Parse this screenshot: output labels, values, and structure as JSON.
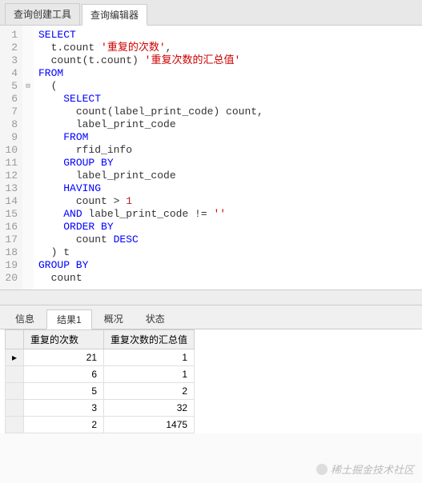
{
  "top_tabs": {
    "builder": "查询创建工具",
    "editor": "查询编辑器"
  },
  "sql_tokens": [
    [
      {
        "t": "kw",
        "v": "SELECT"
      }
    ],
    [
      {
        "t": "sp",
        "v": "  "
      },
      {
        "t": "id",
        "v": "t.count "
      },
      {
        "t": "str",
        "v": "'重复的次数'"
      },
      {
        "t": "id",
        "v": ","
      }
    ],
    [
      {
        "t": "sp",
        "v": "  "
      },
      {
        "t": "fn",
        "v": "count(t.count) "
      },
      {
        "t": "str",
        "v": "'重复次数的汇总值'"
      }
    ],
    [
      {
        "t": "kw",
        "v": "FROM"
      }
    ],
    [
      {
        "t": "sp",
        "v": "  "
      },
      {
        "t": "id",
        "v": "("
      }
    ],
    [
      {
        "t": "sp",
        "v": "    "
      },
      {
        "t": "kw",
        "v": "SELECT"
      }
    ],
    [
      {
        "t": "sp",
        "v": "      "
      },
      {
        "t": "fn",
        "v": "count(label_print_code) count,"
      }
    ],
    [
      {
        "t": "sp",
        "v": "      "
      },
      {
        "t": "id",
        "v": "label_print_code"
      }
    ],
    [
      {
        "t": "sp",
        "v": "    "
      },
      {
        "t": "kw",
        "v": "FROM"
      }
    ],
    [
      {
        "t": "sp",
        "v": "      "
      },
      {
        "t": "id",
        "v": "rfid_info"
      }
    ],
    [
      {
        "t": "sp",
        "v": "    "
      },
      {
        "t": "kw",
        "v": "GROUP BY"
      }
    ],
    [
      {
        "t": "sp",
        "v": "      "
      },
      {
        "t": "id",
        "v": "label_print_code"
      }
    ],
    [
      {
        "t": "sp",
        "v": "    "
      },
      {
        "t": "kw",
        "v": "HAVING"
      }
    ],
    [
      {
        "t": "sp",
        "v": "      "
      },
      {
        "t": "id",
        "v": "count > "
      },
      {
        "t": "num",
        "v": "1"
      }
    ],
    [
      {
        "t": "sp",
        "v": "    "
      },
      {
        "t": "kw",
        "v": "AND"
      },
      {
        "t": "id",
        "v": " label_print_code != "
      },
      {
        "t": "str",
        "v": "''"
      }
    ],
    [
      {
        "t": "sp",
        "v": "    "
      },
      {
        "t": "kw",
        "v": "ORDER BY"
      }
    ],
    [
      {
        "t": "sp",
        "v": "      "
      },
      {
        "t": "id",
        "v": "count "
      },
      {
        "t": "kw",
        "v": "DESC"
      }
    ],
    [
      {
        "t": "sp",
        "v": "  "
      },
      {
        "t": "id",
        "v": ") t"
      }
    ],
    [
      {
        "t": "kw",
        "v": "GROUP BY"
      }
    ],
    [
      {
        "t": "sp",
        "v": "  "
      },
      {
        "t": "id",
        "v": "count"
      }
    ]
  ],
  "fold_row": 5,
  "bottom_tabs": {
    "info": "信息",
    "result1": "结果1",
    "profile": "概况",
    "status": "状态"
  },
  "results": {
    "columns": [
      "重复的次数",
      "重复次数的汇总值"
    ],
    "rows": [
      [
        "21",
        "1"
      ],
      [
        "6",
        "1"
      ],
      [
        "5",
        "2"
      ],
      [
        "3",
        "32"
      ],
      [
        "2",
        "1475"
      ]
    ]
  },
  "watermark": "稀土掘金技术社区"
}
